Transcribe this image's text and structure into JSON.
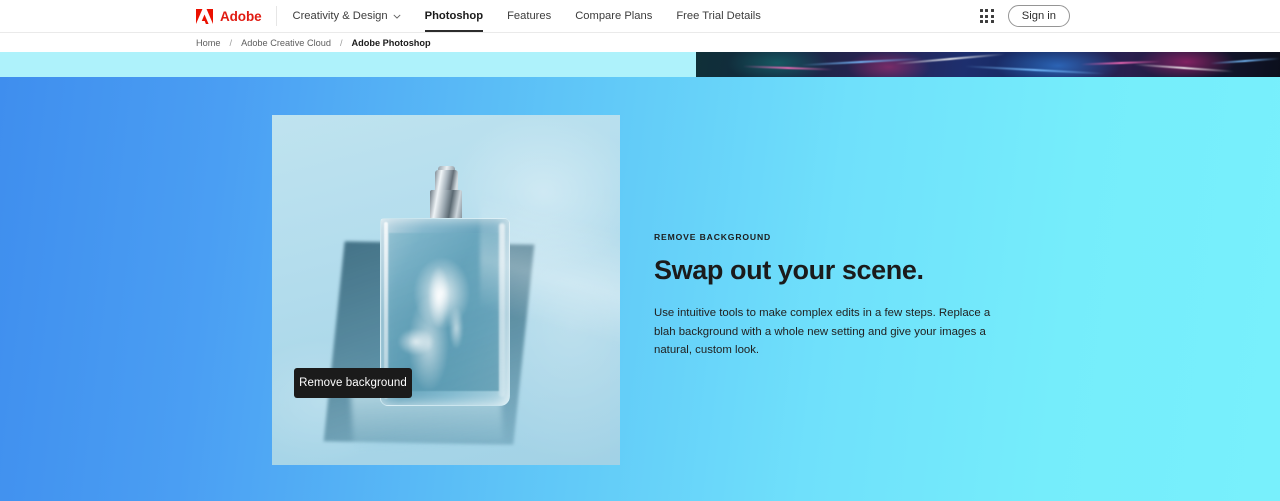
{
  "nav": {
    "brand": {
      "name": "Adobe",
      "logo_icon": "adobe-a-logo",
      "brand_color": "#e01b12"
    },
    "primary": [
      {
        "label": "Creativity & Design",
        "has_dropdown": true,
        "chevron_icon": "chevron-down-icon",
        "active": false
      },
      {
        "label": "Photoshop",
        "has_dropdown": false,
        "active": true
      },
      {
        "label": "Features",
        "has_dropdown": false,
        "active": false
      },
      {
        "label": "Compare Plans",
        "has_dropdown": false,
        "active": false
      },
      {
        "label": "Free Trial Details",
        "has_dropdown": false,
        "active": false
      }
    ],
    "app_switcher_icon": "app-grid-icon",
    "sign_in_label": "Sign in"
  },
  "breadcrumb": {
    "separator": "/",
    "items": [
      {
        "label": "Home",
        "current": false
      },
      {
        "label": "Adobe Creative Cloud",
        "current": false
      },
      {
        "label": "Adobe Photoshop",
        "current": true
      }
    ]
  },
  "hero": {
    "background_from": "#3f8eee",
    "background_to": "#78f0fc",
    "eyebrow": "Remove background",
    "headline": "Swap out your scene.",
    "blurb": "Use intuitive tools to make complex edits in a few steps. Replace a blah background with a whole new setting and give your images a natural, custom look.",
    "media": {
      "alt": "Glass perfume bottle with silver spray cap on a light blue background",
      "overlay_chip_label": "Remove background",
      "chip_background": "#1b1b1b",
      "chip_text_color": "#ffffff"
    }
  },
  "decor_strip": {
    "alt": "Abstract dark blue and magenta light streaks banner",
    "left_fill": "#aef2fb"
  }
}
